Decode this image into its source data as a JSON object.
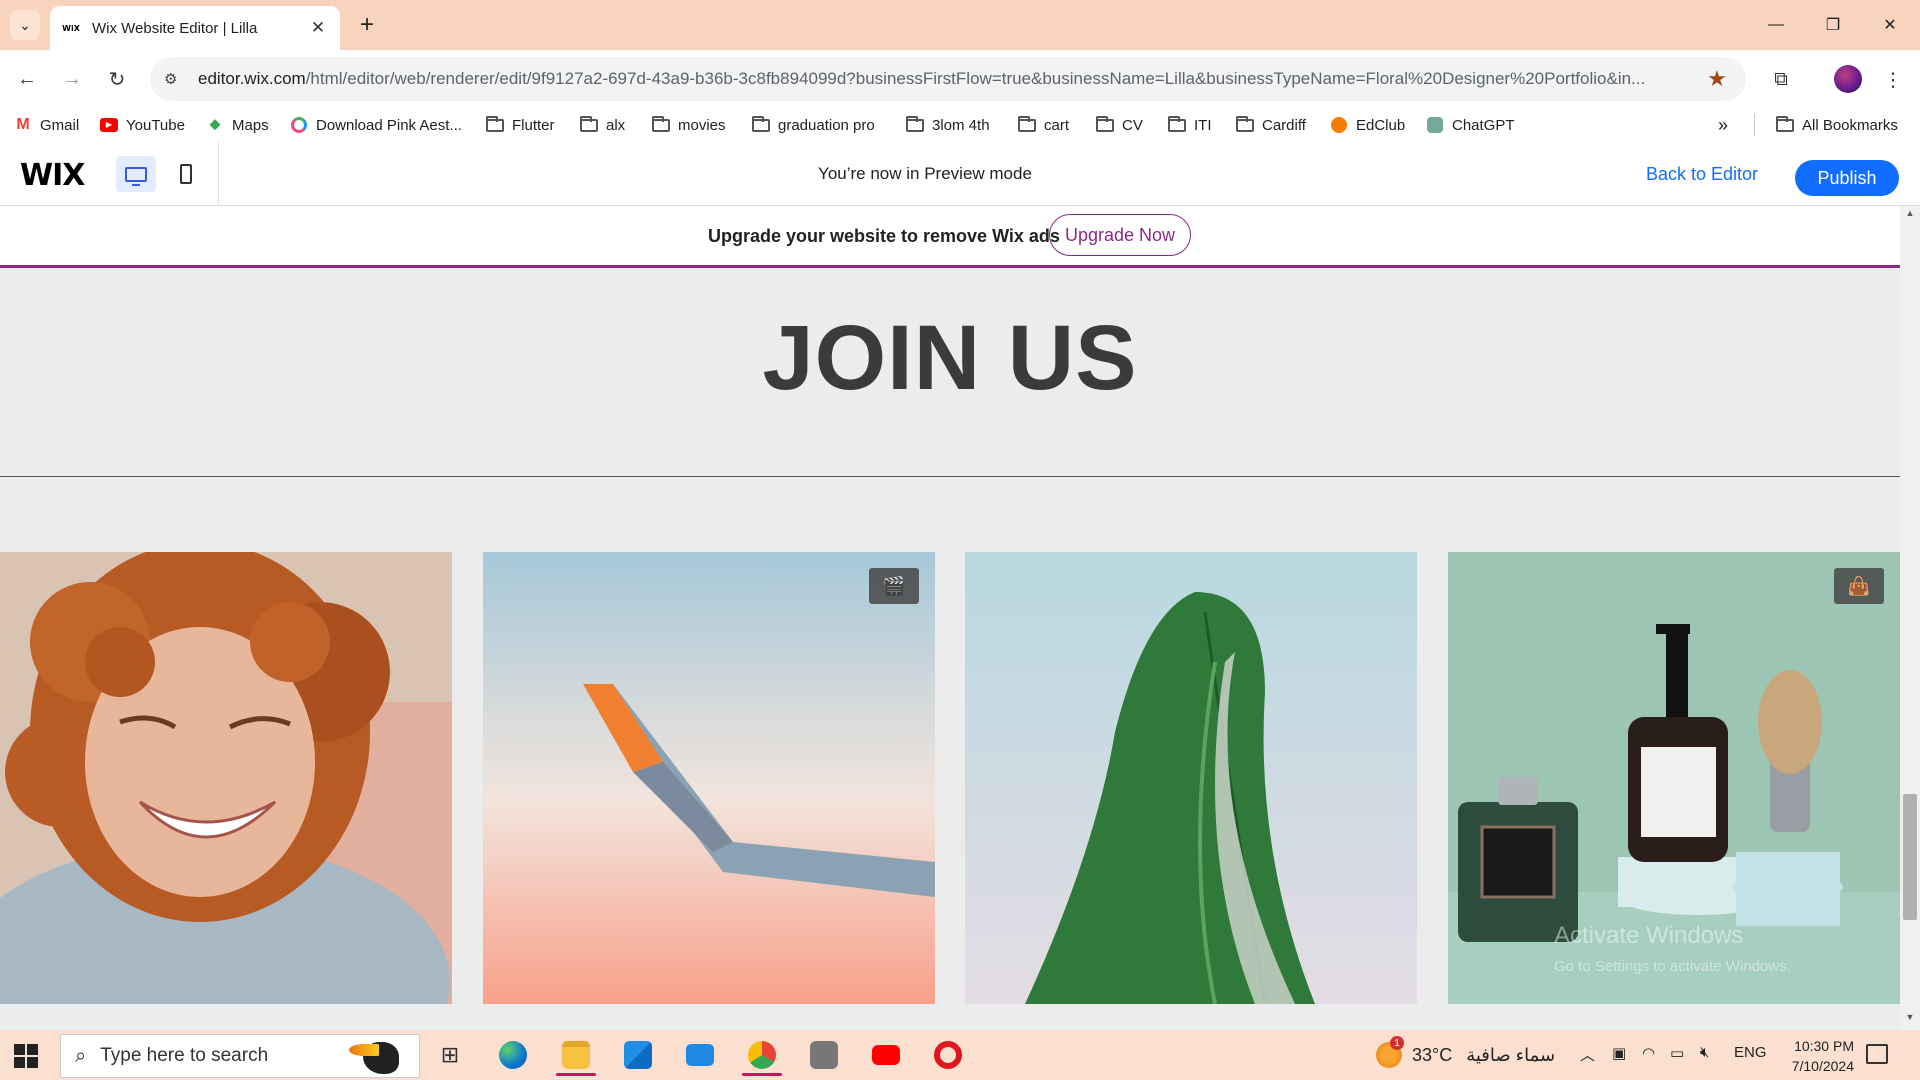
{
  "browser": {
    "tab": {
      "favicon_text": "WiX",
      "title": "Wix Website Editor | Lilla"
    },
    "address": {
      "host": "editor.wix.com",
      "path": "/html/editor/web/renderer/edit/9f9127a2-697d-43a9-b36b-3c8fb894099d?businessFirstFlow=true&businessName=Lilla&businessTypeName=Floral%20Designer%20Portfolio&in..."
    },
    "bookmarks": [
      {
        "label": "Gmail",
        "icon": "gmail-icon"
      },
      {
        "label": "YouTube",
        "icon": "youtube-icon"
      },
      {
        "label": "Maps",
        "icon": "maps-icon"
      },
      {
        "label": "Download Pink Aest...",
        "icon": "site-icon"
      },
      {
        "label": "Flutter",
        "icon": "folder-icon"
      },
      {
        "label": "alx",
        "icon": "folder-icon"
      },
      {
        "label": "movies",
        "icon": "folder-icon"
      },
      {
        "label": "graduation pro",
        "icon": "folder-icon"
      },
      {
        "label": "3lom 4th",
        "icon": "folder-icon"
      },
      {
        "label": "cart",
        "icon": "folder-icon"
      },
      {
        "label": "CV",
        "icon": "folder-icon"
      },
      {
        "label": "ITI",
        "icon": "folder-icon"
      },
      {
        "label": "Cardiff",
        "icon": "folder-icon"
      },
      {
        "label": "EdClub",
        "icon": "edclub-icon"
      },
      {
        "label": "ChatGPT",
        "icon": "chatgpt-icon"
      }
    ],
    "all_bookmarks": "All Bookmarks"
  },
  "wix_header": {
    "logo": "WIX",
    "preview_text": "You’re now in Preview mode",
    "back_to_editor": "Back to Editor",
    "publish": "Publish",
    "accent": "#116dff"
  },
  "upgrade_banner": {
    "text": "Upgrade your website to remove Wix ads",
    "button": "Upgrade Now",
    "accent": "#8e2a86"
  },
  "main": {
    "heading": "JOIN US",
    "tiles": [
      {
        "name": "smiling-woman-photo",
        "badge": ""
      },
      {
        "name": "airplane-wing-photo",
        "badge": "video-icon"
      },
      {
        "name": "banana-leaf-photo",
        "badge": ""
      },
      {
        "name": "grooming-products-photo",
        "badge": "shopping-bag-icon"
      }
    ],
    "watermark_title": "Activate Windows",
    "watermark_sub": "Go to Settings to activate Windows."
  },
  "taskbar": {
    "search_placeholder": "Type here to search",
    "weather_temp": "33°C",
    "weather_desc": "سماء صافية",
    "weather_badge": "1",
    "language": "ENG",
    "time": "10:30 PM",
    "date": "7/10/2024"
  }
}
